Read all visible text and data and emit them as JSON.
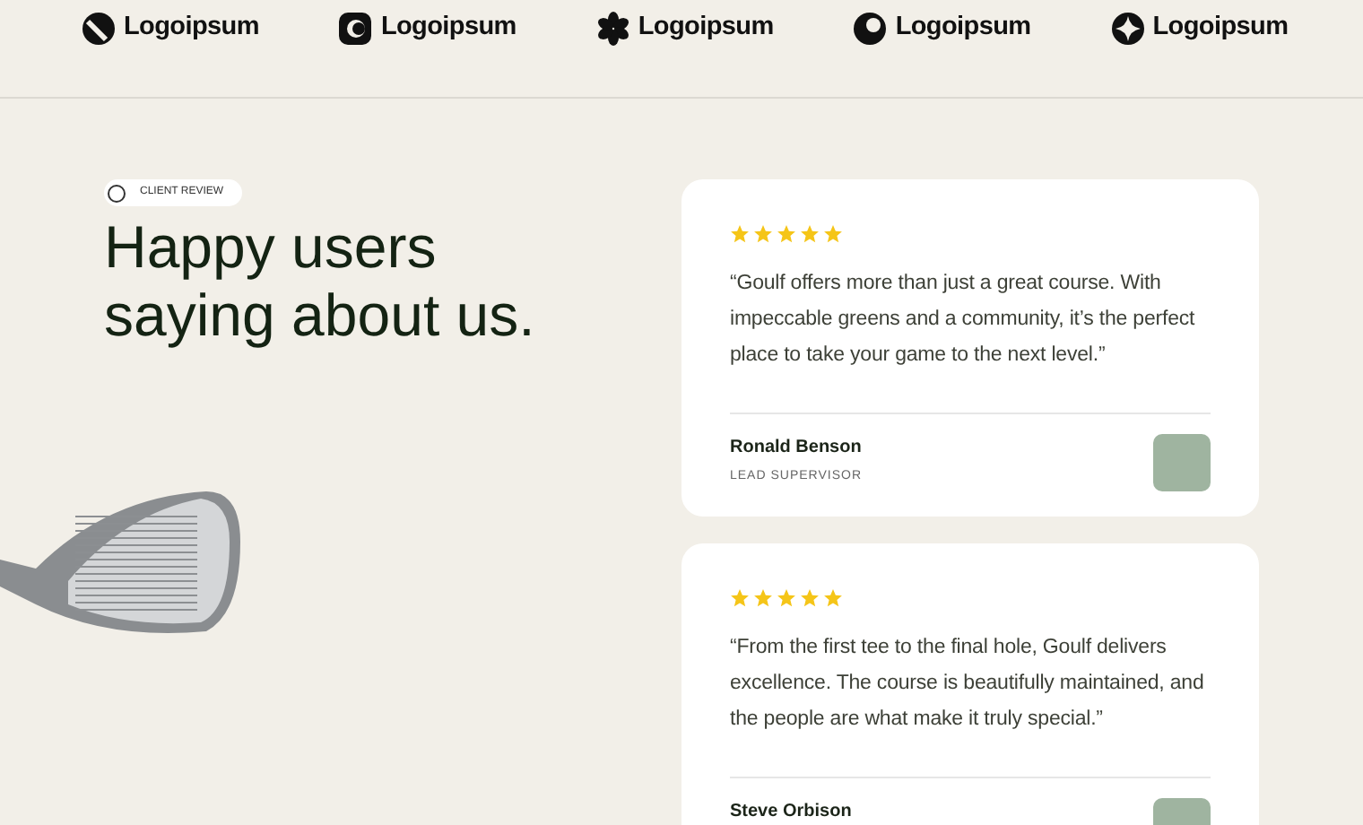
{
  "logos": [
    {
      "kind": "slash",
      "label": "Logoipsum"
    },
    {
      "kind": "ring",
      "label": "Logoipsum"
    },
    {
      "kind": "petals",
      "label": "Logoipsum"
    },
    {
      "kind": "crescent",
      "label": "Logoipsum"
    },
    {
      "kind": "star",
      "label": "Logoipsum"
    }
  ],
  "badge": {
    "label": "CLIENT REVIEW"
  },
  "heading": [
    "Happy users",
    "saying about us."
  ],
  "reviews": [
    {
      "stars": 5,
      "quote": "“Goulf offers more than just a great course. With impeccable greens and a community, it’s the perfect place to take your game to the next level.”",
      "name": "Ronald Benson",
      "role": "LEAD SUPERVISOR"
    },
    {
      "stars": 5,
      "quote": "“From the first tee to the final hole, Goulf delivers excellence. The course is beautifully maintained, and the people are what make it truly special.”",
      "name": "Steve Orbison"
    }
  ]
}
